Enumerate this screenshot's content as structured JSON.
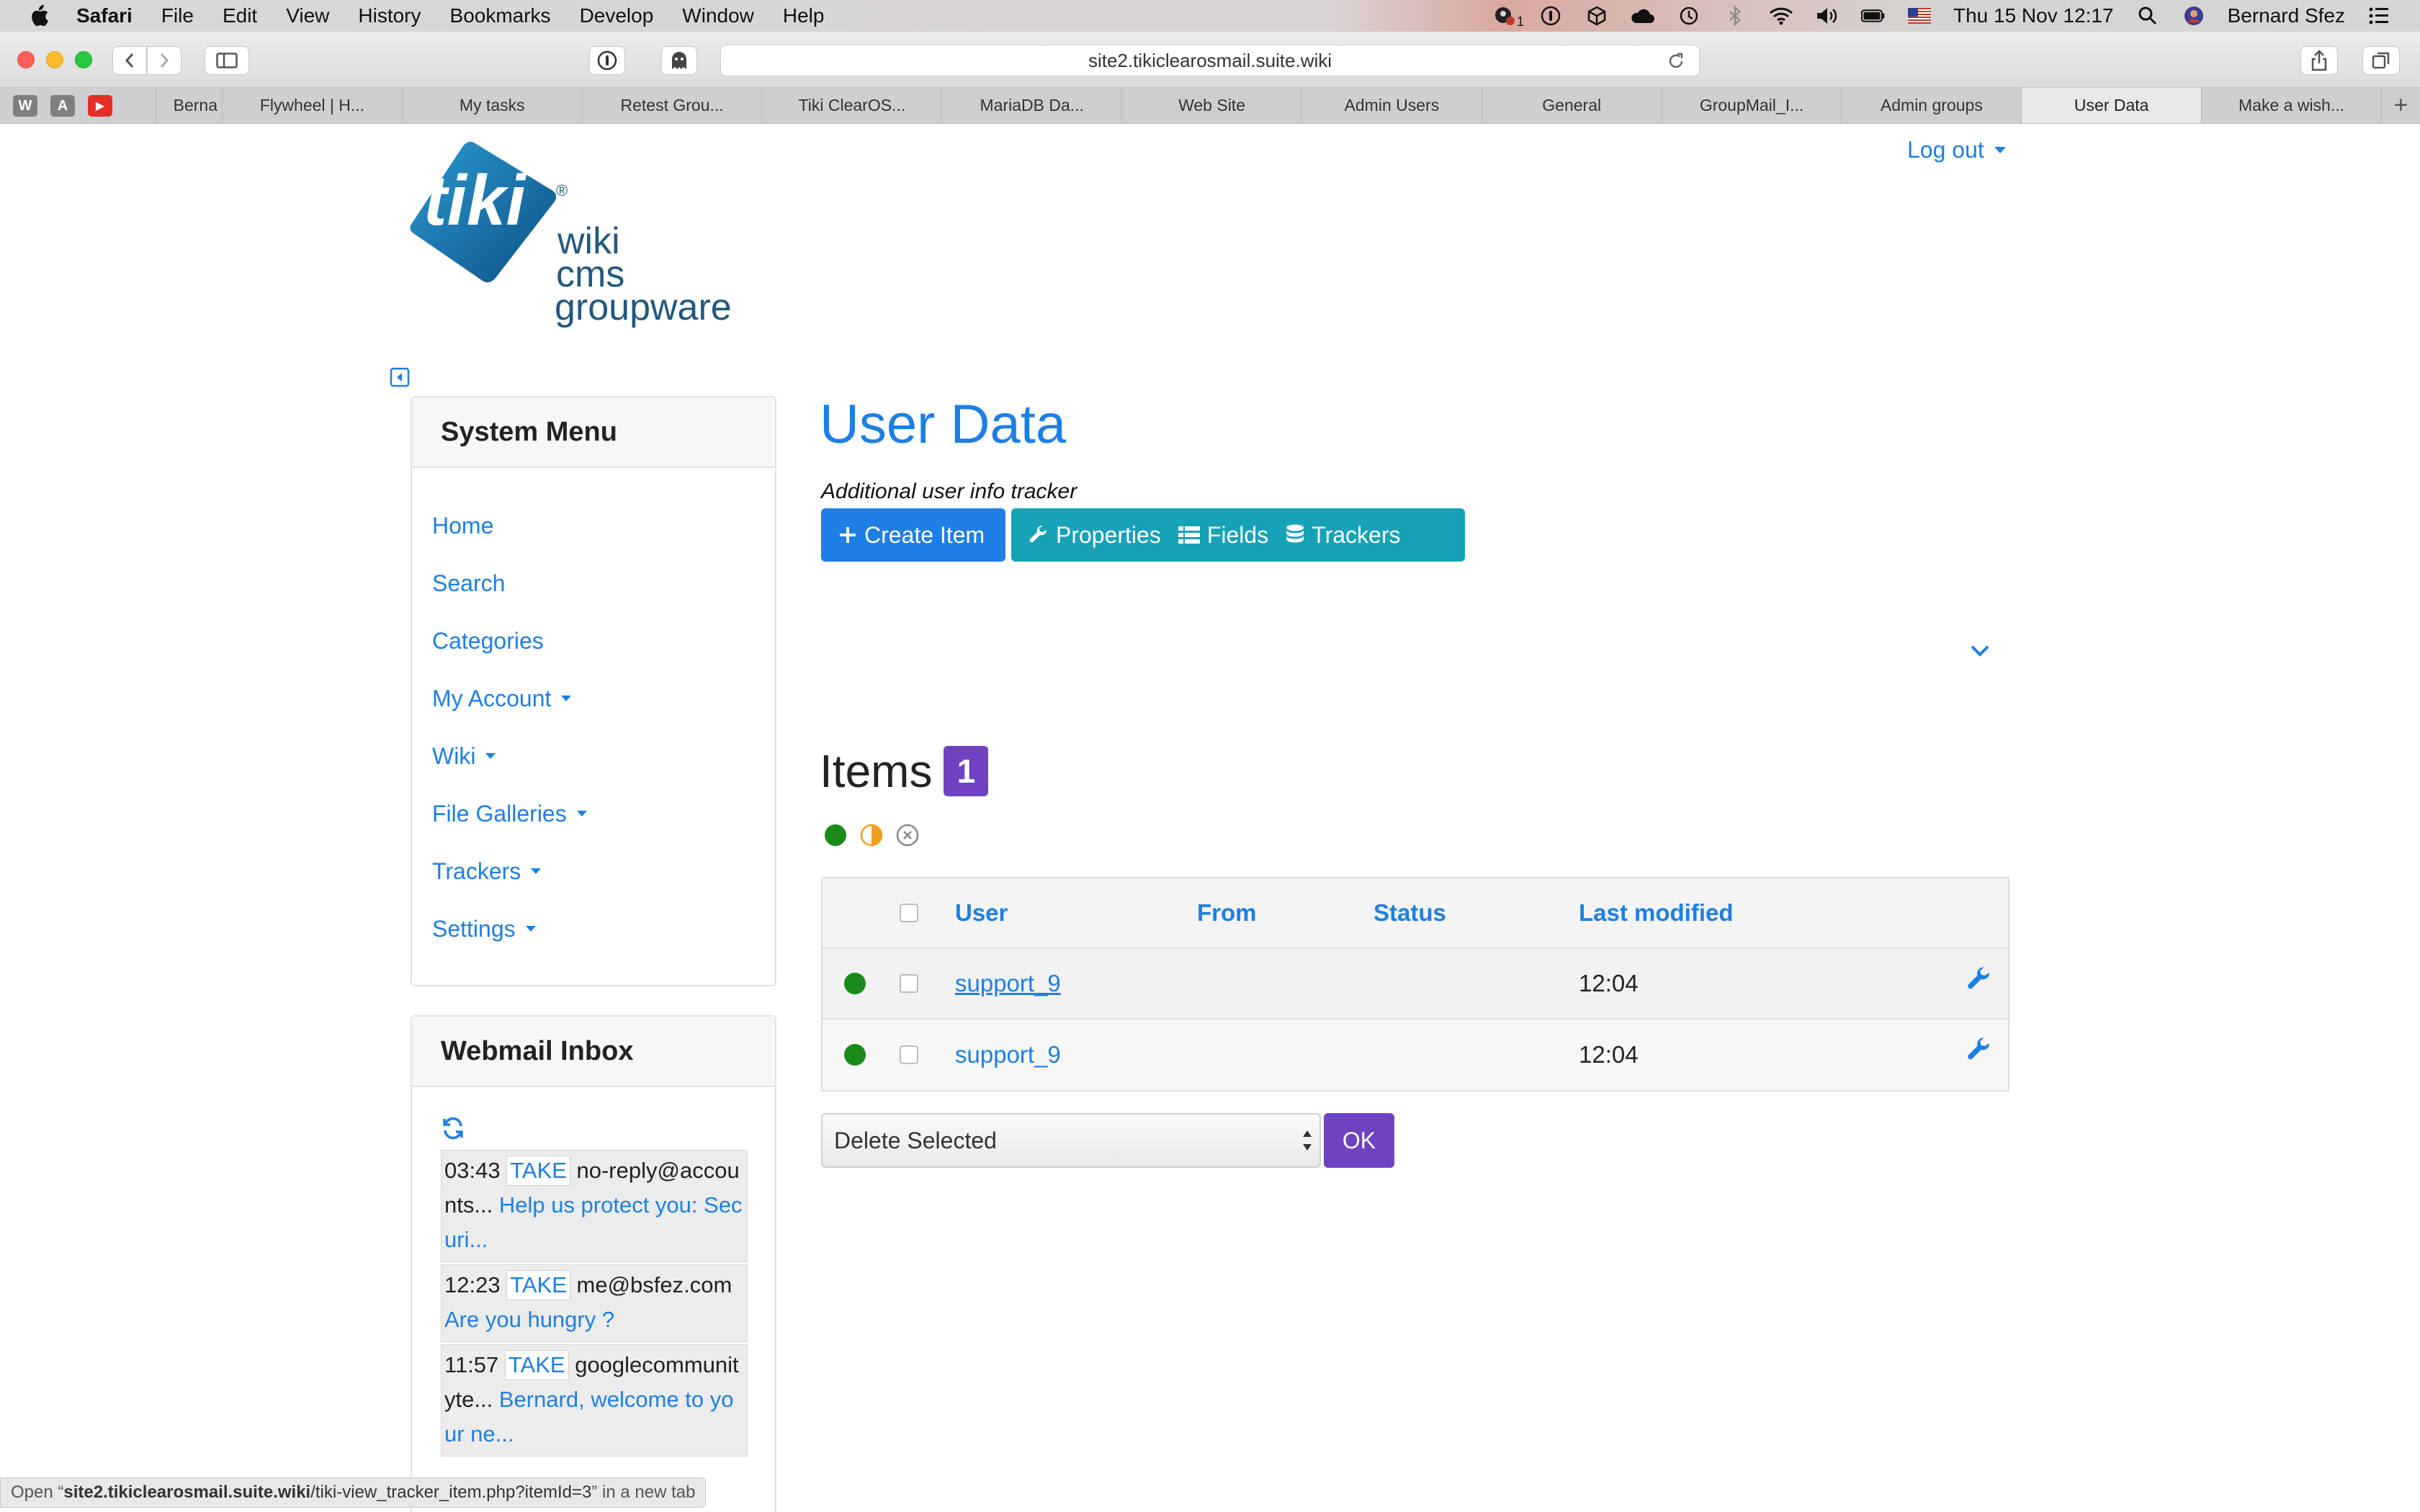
{
  "menubar": {
    "app": "Safari",
    "items": [
      "File",
      "Edit",
      "View",
      "History",
      "Bookmarks",
      "Develop",
      "Window",
      "Help"
    ],
    "notification_count": "1",
    "datetime": "Thu 15 Nov  12:17",
    "user": "Bernard Sfez"
  },
  "toolbar": {
    "url": "site2.tikiclearosmail.suite.wiki"
  },
  "tabs": {
    "favicons": [
      "W",
      "A",
      "▶"
    ],
    "items": [
      "Berna",
      "Flywheel | H...",
      "My tasks",
      "Retest Grou...",
      "Tiki ClearOS...",
      "MariaDB Da...",
      "Web Site",
      "Admin Users",
      "General",
      "GroupMail_I...",
      "Admin groups",
      "User Data",
      "Make a wish..."
    ],
    "active_index": 11,
    "add_label": "+"
  },
  "header": {
    "logout_label": "Log out"
  },
  "logo": {
    "mark_text": "tiki",
    "registered": "®",
    "line1": "wiki",
    "line2": "cms",
    "line3": "groupware"
  },
  "system_menu": {
    "title": "System Menu",
    "items": [
      {
        "label": "Home",
        "dropdown": false
      },
      {
        "label": "Search",
        "dropdown": false
      },
      {
        "label": "Categories",
        "dropdown": false
      },
      {
        "label": "My Account",
        "dropdown": true
      },
      {
        "label": "Wiki",
        "dropdown": true
      },
      {
        "label": "File Galleries",
        "dropdown": true
      },
      {
        "label": "Trackers",
        "dropdown": true
      },
      {
        "label": "Settings",
        "dropdown": true
      }
    ]
  },
  "webmail": {
    "title": "Webmail Inbox",
    "take_label": "TAKE",
    "messages": [
      {
        "time": "03:43",
        "from": "no-reply@accounts...",
        "subject": "Help us protect you: Securi..."
      },
      {
        "time": "12:23",
        "from": "me@bsfez.com",
        "subject": "Are you hungry ?"
      },
      {
        "time": "11:57",
        "from": "googlecommunityte...",
        "subject": "Bernard, welcome to your ne..."
      }
    ]
  },
  "main": {
    "title": "User Data",
    "subtitle": "Additional user info tracker",
    "buttons": {
      "create": "Create Item",
      "properties": "Properties",
      "fields": "Fields",
      "trackers": "Trackers"
    },
    "items_heading": "Items",
    "items_count": "1",
    "status_colors": {
      "open": "#1a8a1a",
      "pending": "#f0a020",
      "closed": "#888888"
    }
  },
  "table": {
    "headers": {
      "user": "User",
      "from": "From",
      "status": "Status",
      "last_modified": "Last modified"
    },
    "rows": [
      {
        "user": "support_9",
        "from": "",
        "status": "",
        "last_modified": "12:04"
      },
      {
        "user": "support_9",
        "from": "",
        "status": "",
        "last_modified": "12:04"
      }
    ]
  },
  "bulk": {
    "action_selected": "Delete Selected",
    "ok_label": "OK"
  },
  "statusbar": {
    "prefix": "Open “",
    "host": "site2.tikiclearosmail.suite.wiki",
    "path": "/tiki-view_tracker_item.php?itemId=3",
    "suffix": "” in a new tab"
  }
}
